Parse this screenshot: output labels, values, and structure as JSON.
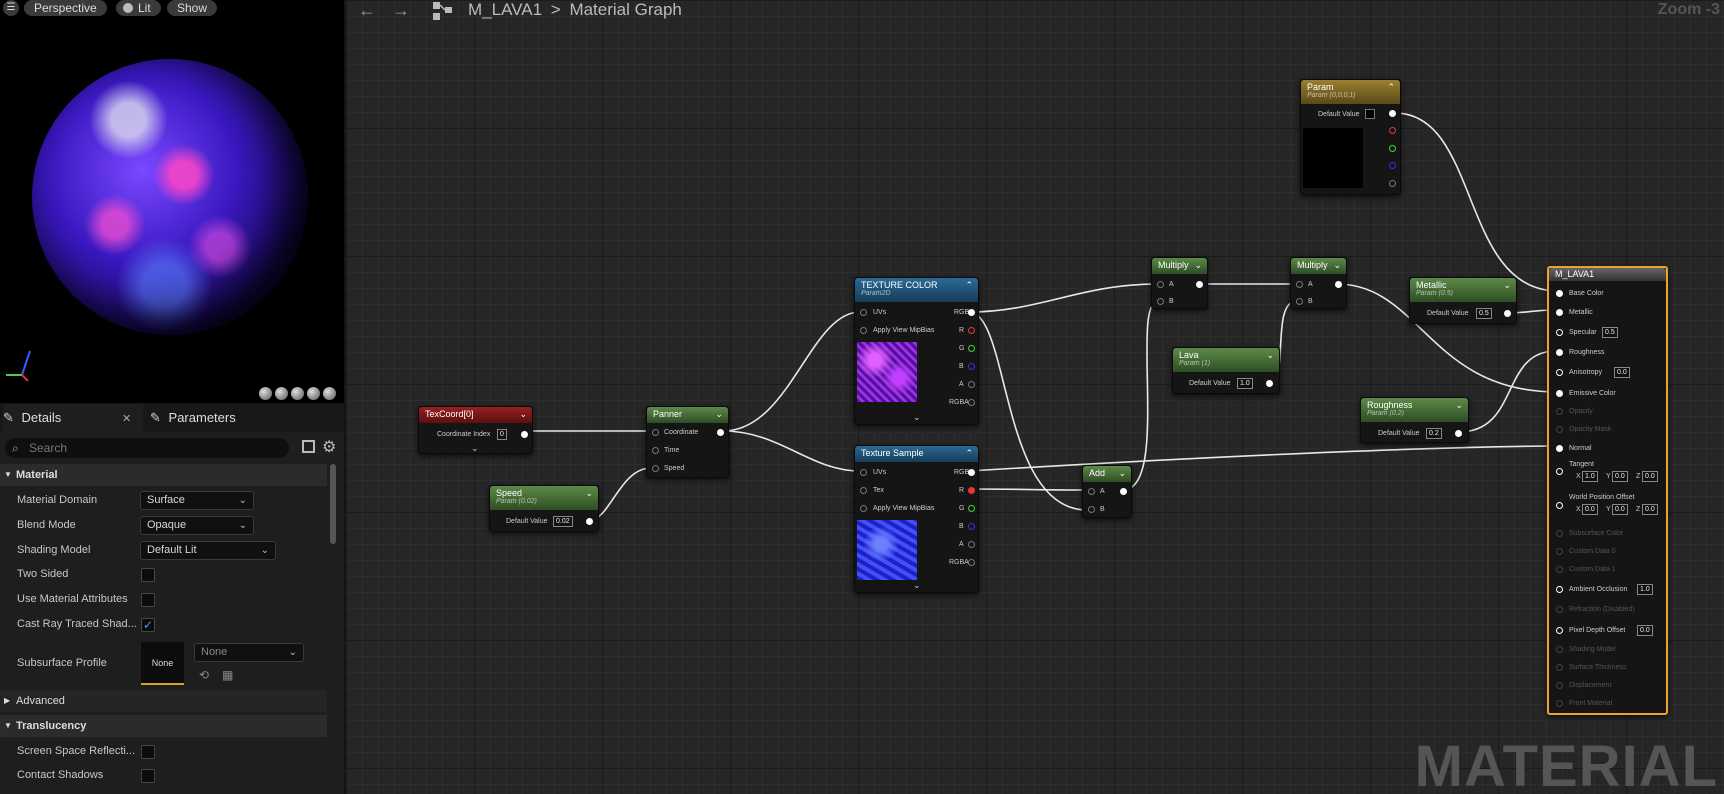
{
  "viewport": {
    "menu_icon": "hamburger-icon",
    "perspective": "Perspective",
    "lit": "Lit",
    "show": "Show"
  },
  "panel": {
    "tab_details": "Details",
    "tab_parameters": "Parameters",
    "search_placeholder": "Search"
  },
  "sections": {
    "material": "Material",
    "advanced": "Advanced",
    "translucency": "Translucency"
  },
  "props": {
    "material_domain": {
      "label": "Material Domain",
      "value": "Surface"
    },
    "blend_mode": {
      "label": "Blend Mode",
      "value": "Opaque"
    },
    "shading_model": {
      "label": "Shading Model",
      "value": "Default Lit"
    },
    "two_sided": {
      "label": "Two Sided",
      "checked": false
    },
    "use_material_attributes": {
      "label": "Use Material Attributes",
      "checked": false
    },
    "cast_ray_traced": {
      "label": "Cast Ray Traced Shad...",
      "checked": true
    },
    "subsurface_profile": {
      "label": "Subsurface Profile",
      "thumb": "None",
      "value": "None"
    },
    "screen_space": {
      "label": "Screen Space Reflecti...",
      "checked": false
    },
    "contact_shadows": {
      "label": "Contact Shadows",
      "checked": false
    }
  },
  "toolbar": {
    "back": "←",
    "forward": "→",
    "crumb_asset": "M_LAVA1",
    "crumb_sep": ">",
    "crumb_graph": "Material Graph",
    "zoom": "Zoom -3"
  },
  "watermark": "MATERIAL",
  "nodes": {
    "texcoord": {
      "title": "TexCoord[0]",
      "coord_label": "Coordinate Index",
      "coord_value": "0"
    },
    "speed": {
      "title": "Speed",
      "sub": "Param (0.02)",
      "dv_label": "Default Value",
      "value": "0.02"
    },
    "panner": {
      "title": "Panner",
      "pins": [
        "Coordinate",
        "Time",
        "Speed"
      ]
    },
    "texcolor": {
      "title": "TEXTURE COLOR",
      "sub": "Param2D",
      "uvs": "UVs",
      "mip": "Apply View MipBias",
      "outputs": [
        "RGB",
        "R",
        "G",
        "B",
        "A",
        "RGBA"
      ]
    },
    "texsample": {
      "title": "Texture Sample",
      "uvs": "UVs",
      "tex": "Tex",
      "mip": "Apply View MipBias",
      "outputs": [
        "RGB",
        "R",
        "G",
        "B",
        "A",
        "RGBA"
      ]
    },
    "add": {
      "title": "Add",
      "a": "A",
      "b": "B"
    },
    "multiply1": {
      "title": "Multiply",
      "a": "A",
      "b": "B"
    },
    "multiply2": {
      "title": "Multiply",
      "a": "A",
      "b": "B"
    },
    "lava": {
      "title": "Lava",
      "sub": "Param (1)",
      "dv_label": "Default Value",
      "value": "1.0"
    },
    "param": {
      "title": "Param",
      "sub": "Param (0,0,0,1)",
      "dv_label": "Default Value"
    },
    "metallic": {
      "title": "Metallic",
      "sub": "Param (0.5)",
      "dv_label": "Default Value",
      "value": "0.5"
    },
    "roughness": {
      "title": "Roughness",
      "sub": "Param (0.2)",
      "dv_label": "Default Value",
      "value": "0.2"
    },
    "root": {
      "title": "M_LAVA1",
      "base_color": "Base Color",
      "metallic": "Metallic",
      "specular": "Specular",
      "specular_value": "0.5",
      "roughness": "Roughness",
      "anisotropy": "Anisotropy",
      "anisotropy_value": "0.0",
      "emissive": "Emissive Color",
      "opacity": "Opacity",
      "opacity_mask": "Opacity Mask",
      "normal": "Normal",
      "tangent": "Tangent",
      "tangent_x": "1.0",
      "tangent_y": "0.0",
      "tangent_z": "0.0",
      "wpo": "World Position Offset",
      "wpo_x": "0.0",
      "wpo_y": "0.0",
      "wpo_z": "0.0",
      "subsurface": "Subsurface Color",
      "custom0": "Custom Data 0",
      "custom1": "Custom Data 1",
      "ao": "Ambient Occlusion",
      "ao_value": "1.0",
      "refraction": "Refraction (Disabled)",
      "pdo": "Pixel Depth Offset",
      "pdo_value": "0.0",
      "shading_model": "Shading Model",
      "surface_thickness": "Surface Thickness",
      "displacement": "Displacement",
      "front_material": "Front Material",
      "axis_x": "X",
      "axis_y": "Y",
      "axis_z": "Z"
    }
  }
}
